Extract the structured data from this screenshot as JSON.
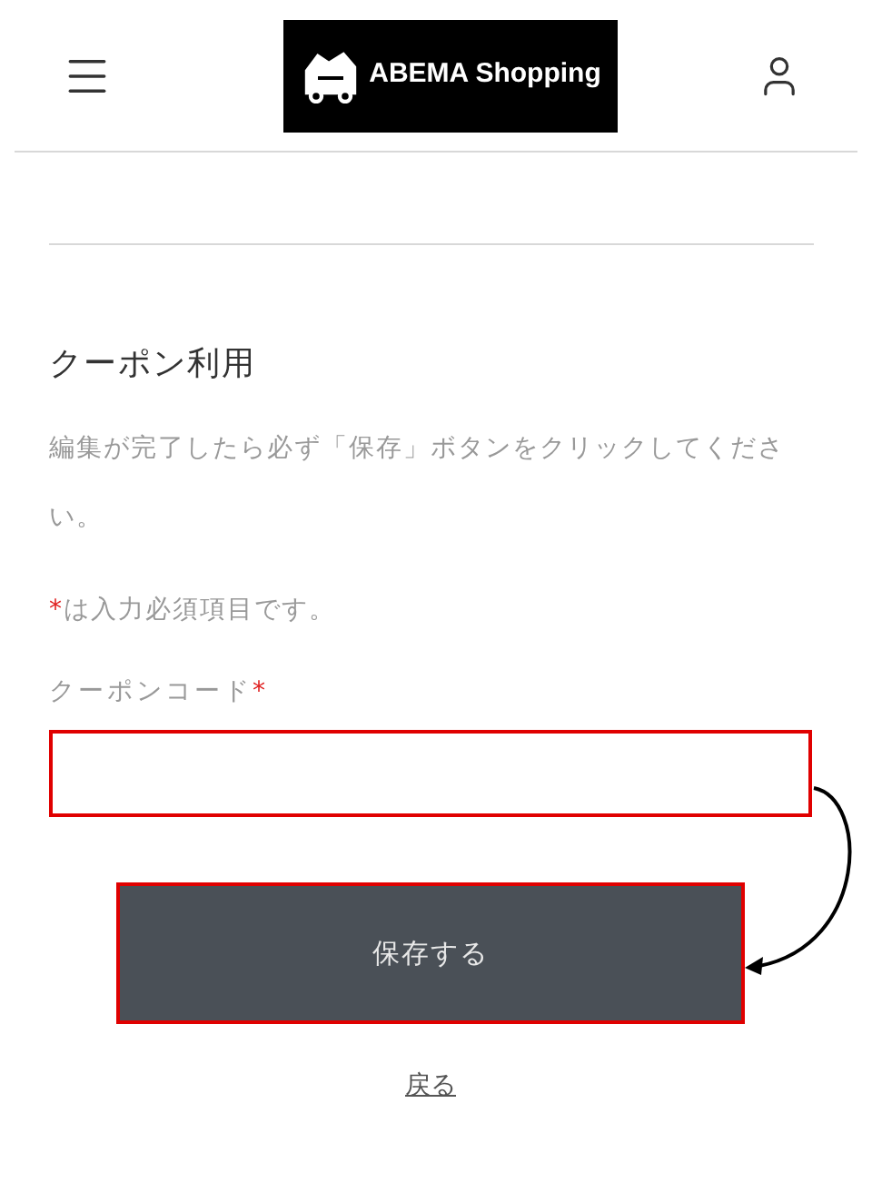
{
  "header": {
    "logo_text": "ABEMA Shopping"
  },
  "form": {
    "title": "クーポン利用",
    "note": "編集が完了したら必ず「保存」ボタンをクリックしてください。",
    "required_mark": "*",
    "required_note": "は入力必須項目です。",
    "field": {
      "label": "クーポンコード",
      "required_mark": "*",
      "highlighted": true
    },
    "save_button": {
      "label": "保存する",
      "highlighted": true
    },
    "back_link": "戻る"
  }
}
